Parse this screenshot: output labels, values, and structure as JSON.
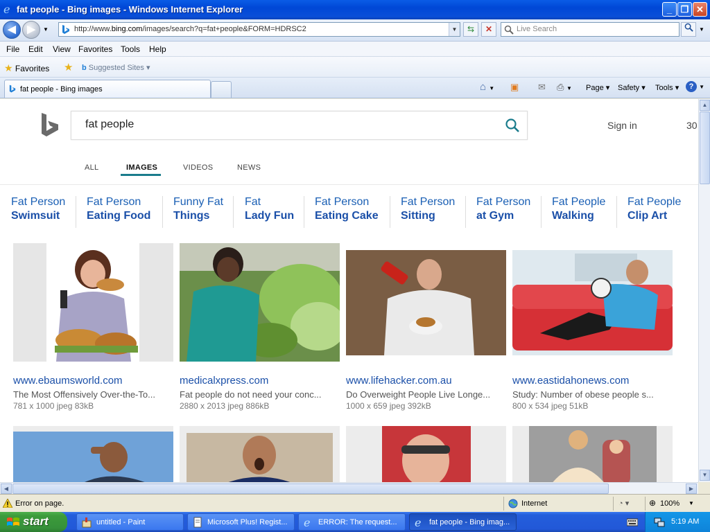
{
  "window": {
    "title": "fat people - Bing images - Windows Internet Explorer",
    "minimize": "_",
    "restore": "❐",
    "close": "✕"
  },
  "address": {
    "url_prefix": "http://www.",
    "url_domain": "bing.com",
    "url_suffix": "/images/search?q=fat+people&FORM=HDRSC2",
    "search_placeholder": "Live Search"
  },
  "menu": [
    "File",
    "Edit",
    "View",
    "Favorites",
    "Tools",
    "Help"
  ],
  "favorites_bar": {
    "favorites": "Favorites",
    "suggested": "Suggested Sites"
  },
  "tab": {
    "label": "fat people - Bing images"
  },
  "command_bar": {
    "page": "Page",
    "safety": "Safety",
    "tools": "Tools"
  },
  "bing": {
    "query": "fat people",
    "sign_in": "Sign in",
    "rewards": "30",
    "scopes": [
      "ALL",
      "IMAGES",
      "VIDEOS",
      "NEWS"
    ],
    "active_scope": "IMAGES",
    "related": [
      {
        "line1": "Fat Person",
        "line2": "Swimsuit"
      },
      {
        "line1": "Fat Person",
        "line2": "Eating Food"
      },
      {
        "line1": "Funny Fat",
        "line2": "Things"
      },
      {
        "line1": "Fat",
        "line2": "Lady Fun"
      },
      {
        "line1": "Fat Person",
        "line2": "Eating Cake"
      },
      {
        "line1": "Fat Person",
        "line2": "Sitting"
      },
      {
        "line1": "Fat Person",
        "line2": "at Gym"
      },
      {
        "line1": "Fat People",
        "line2": "Walking"
      },
      {
        "line1": "Fat People",
        "line2": "Clip Art"
      }
    ],
    "results": [
      {
        "domain": "www.ebaumsworld.com",
        "desc": "The Most Offensively Over-the-To...",
        "meta": "781 x 1000 jpeg 83kB"
      },
      {
        "domain": "medicalxpress.com",
        "desc": "Fat people do not need your conc...",
        "meta": "2880 x 2013 jpeg 886kB"
      },
      {
        "domain": "www.lifehacker.com.au",
        "desc": "Do Overweight People Live Longe...",
        "meta": "1000 x 659 jpeg 392kB"
      },
      {
        "domain": "www.eastidahonews.com",
        "desc": "Study: Number of obese people s...",
        "meta": "800 x 534 jpeg 51kB"
      }
    ]
  },
  "status": {
    "message": "Error on page.",
    "zone": "Internet",
    "zoom": "100%"
  },
  "taskbar": {
    "start": "start",
    "tasks": [
      {
        "label": "untitled - Paint"
      },
      {
        "label": "Microsoft Plus! Regist..."
      },
      {
        "label": "ERROR: The request..."
      },
      {
        "label": "fat people - Bing imag..."
      }
    ],
    "time": "5:19 AM"
  },
  "colors": {
    "link_blue": "#1a4fa8",
    "scope_underline": "#1a7c8c",
    "xp_blue": "#0a4fd8",
    "start_green": "#3c9b3b"
  }
}
